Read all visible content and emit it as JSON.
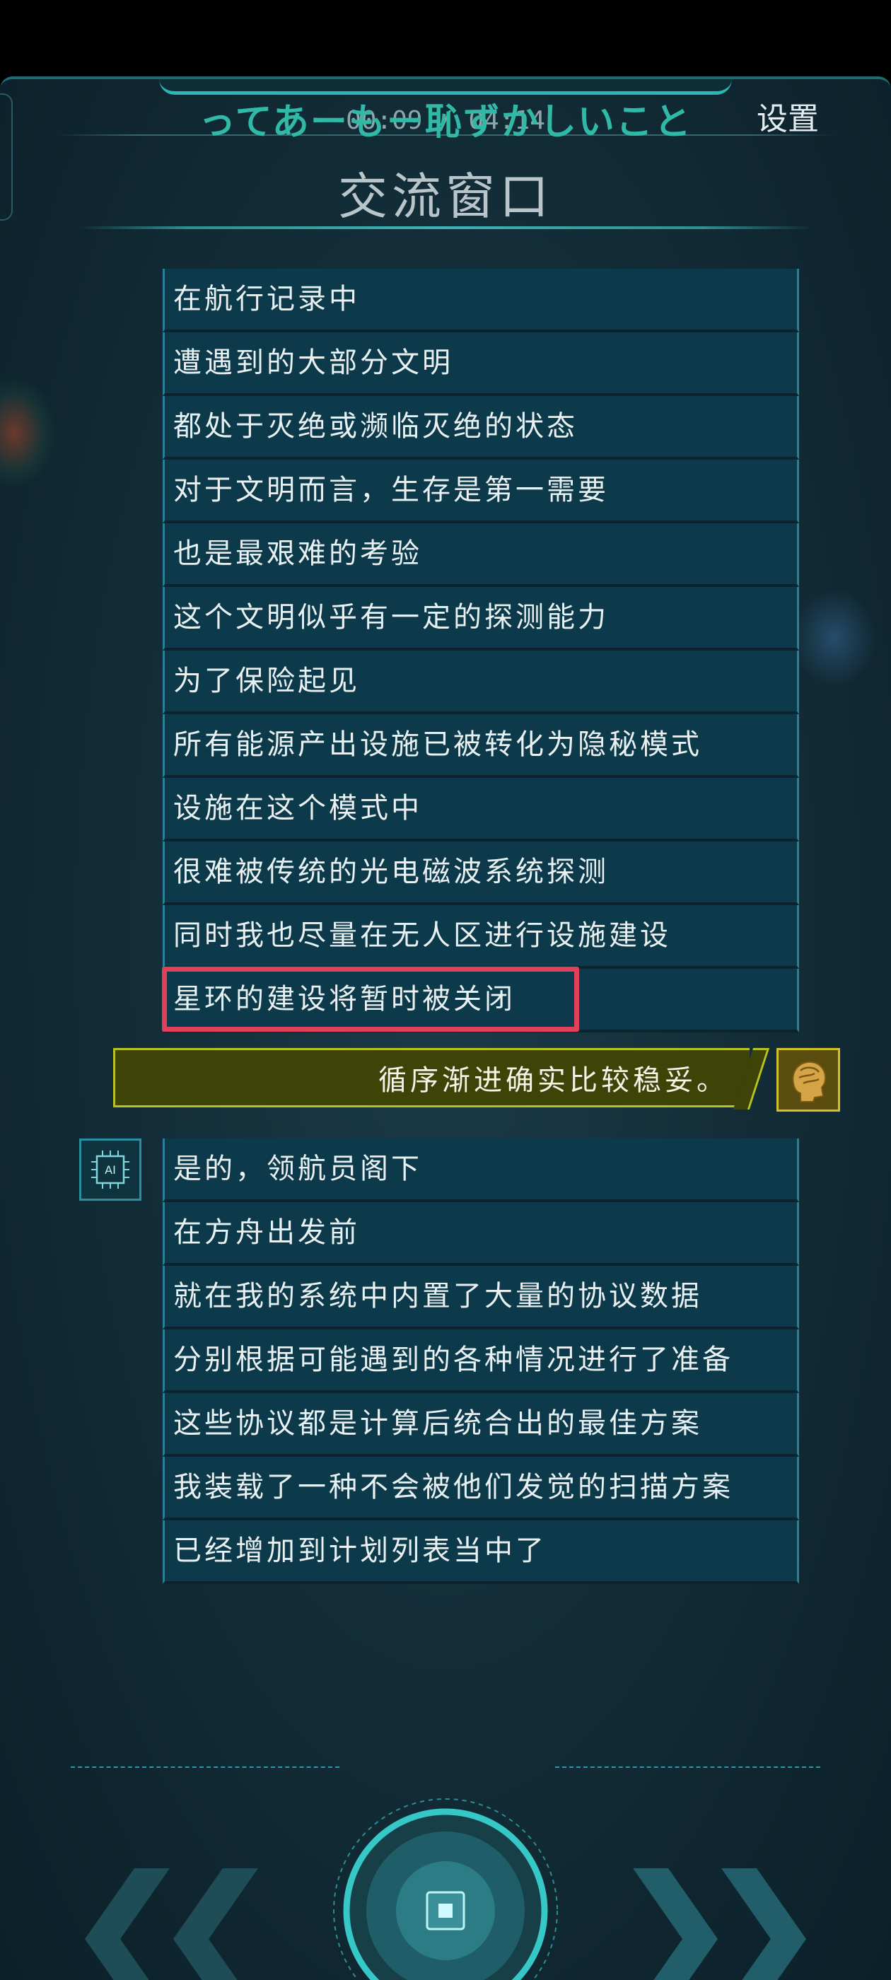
{
  "subtitle_overlay": {
    "timestamp": "00:09 / 04:14",
    "japanese": "ってあーもー恥ずかしいこと"
  },
  "header": {
    "settings_label": "设置",
    "title": "交流窗口"
  },
  "dialogue_a": [
    "在航行记录中",
    "遭遇到的大部分文明",
    "都处于灭绝或濒临灭绝的状态",
    "对于文明而言，生存是第一需要",
    "也是最艰难的考验",
    "这个文明似乎有一定的探测能力",
    "为了保险起见",
    "所有能源产出设施已被转化为隐秘模式",
    "设施在这个模式中",
    "很难被传统的光电磁波系统探测",
    "同时我也尽量在无人区进行设施建设",
    "星环的建设将暂时被关闭"
  ],
  "player_reply": "循序渐进确实比较稳妥。",
  "dialogue_b": [
    "是的，领航员阁下",
    "在方舟出发前",
    "就在我的系统中内置了大量的协议数据",
    "分别根据可能遇到的各种情况进行了准备",
    "这些协议都是计算后统合出的最佳方案",
    "我装载了一种不会被他们发觉的扫描方案",
    "已经增加到计划列表当中了"
  ],
  "icons": {
    "ai_icon_label": "AI",
    "player_avatar": "brain-head-icon",
    "prev": "double-chevron-left-icon",
    "next": "double-chevron-right-icon",
    "center": "circular-action-button"
  },
  "colors": {
    "accent": "#2ec7c4",
    "highlight": "#e0405a",
    "player_bubble": "#3e4308",
    "npc_bubble": "#0d3a4a"
  }
}
